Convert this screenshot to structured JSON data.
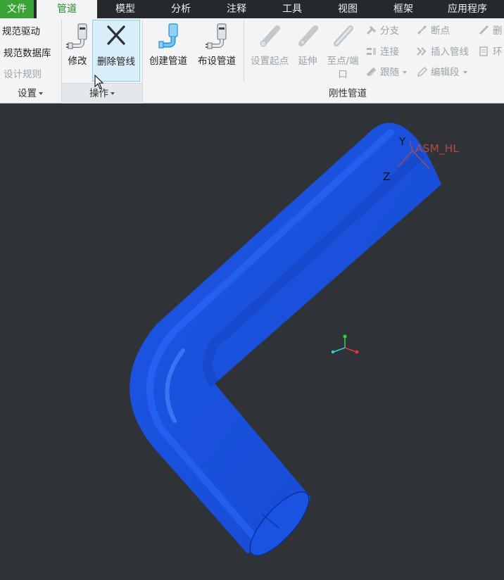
{
  "tabs": {
    "file": "文件",
    "items": [
      {
        "label": "管道"
      },
      {
        "label": "模型"
      },
      {
        "label": "分析"
      },
      {
        "label": "注释"
      },
      {
        "label": "工具"
      },
      {
        "label": "视图"
      },
      {
        "label": "框架"
      },
      {
        "label": "应用程序"
      }
    ]
  },
  "ribbon": {
    "settings": {
      "items": [
        "规范驱动",
        "规范数据库",
        "设计规则"
      ],
      "footer": "设置"
    },
    "operations": {
      "modify": "修改",
      "delete_line": "删除管线",
      "footer": "操作"
    },
    "rigid": {
      "create_pipe": "创建管道",
      "route_pipe": "布设管道",
      "set_start": "设置起点",
      "extend": "延伸",
      "to_point_line1": "至点/端",
      "to_point_line2": "口",
      "branch": "分支",
      "break_point": "断点",
      "delete_partial": "删",
      "connect": "连接",
      "insert_line": "插入管线",
      "ring": "环",
      "follow": "跟随",
      "edit_segment": "编辑段",
      "footer": "刚性管道"
    }
  },
  "viewport": {
    "csys_name": "ASM_HL",
    "axis_y": "Y",
    "axis_z": "Z"
  },
  "colors": {
    "accent": "#3aa335",
    "pipe": "#1b5cf0",
    "background": "#2f3337",
    "csys": "#b04a4a"
  },
  "icons": {
    "cursor": "arrow-cursor-icon"
  }
}
